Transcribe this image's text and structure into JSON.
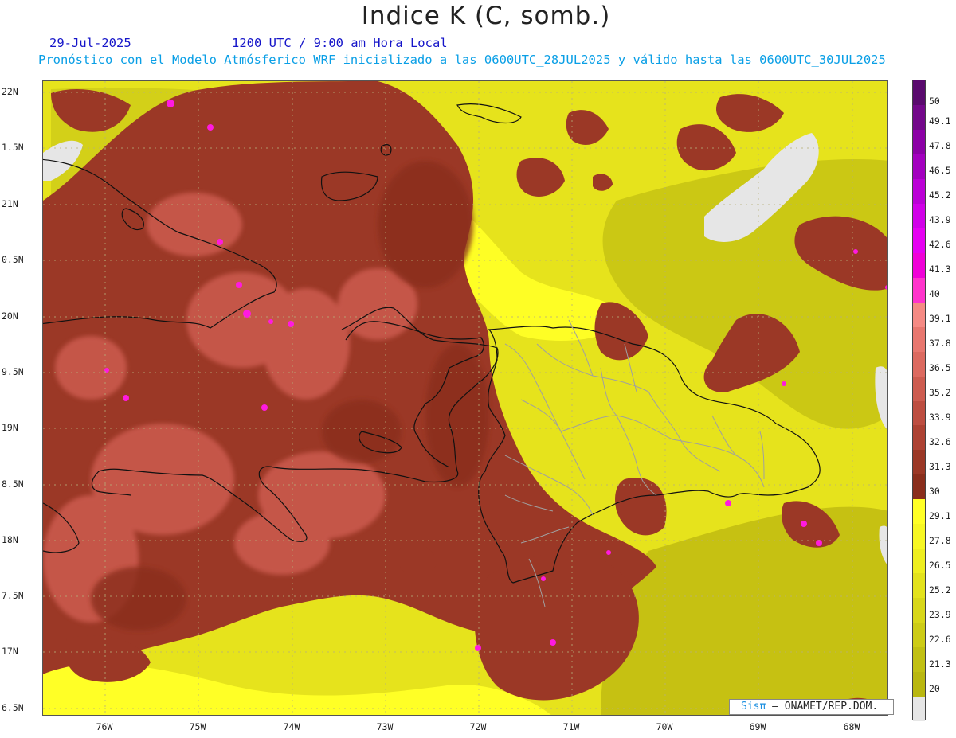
{
  "title": "Indice K (C, somb.)",
  "date": "29-Jul-2025",
  "valid_time": "1200 UTC / 9:00 am Hora Local",
  "forecast_info": "Pronóstico con el Modelo Atmósferico WRF inicializado a las 0600UTC_28JUL2025 y válido hasta las  0600UTC_30JUL2025",
  "lat_labels": [
    "22N",
    "1.5N",
    "21N",
    "0.5N",
    "20N",
    "9.5N",
    "19N",
    "8.5N",
    "18N",
    "7.5N",
    "17N",
    "6.5N"
  ],
  "lon_labels": [
    "76W",
    "75W",
    "74W",
    "73W",
    "72W",
    "71W",
    "70W",
    "69W",
    "68W"
  ],
  "colorbar": {
    "labels": [
      "50",
      "49.1",
      "47.8",
      "46.5",
      "45.2",
      "43.9",
      "42.6",
      "41.3",
      "40",
      "39.1",
      "37.8",
      "36.5",
      "35.2",
      "33.9",
      "32.6",
      "31.3",
      "30",
      "29.1",
      "27.8",
      "26.5",
      "25.2",
      "23.9",
      "22.6",
      "21.3",
      "20"
    ],
    "colors": [
      "#5a0a6e",
      "#73088a",
      "#8c00a6",
      "#a300bf",
      "#bb00d6",
      "#d100e8",
      "#e600f2",
      "#f000d8",
      "#ff33cc",
      "#f58a84",
      "#e8776f",
      "#dc6a60",
      "#cd5c50",
      "#bd4e41",
      "#ad4233",
      "#9b3826",
      "#8a2e1c",
      "#ffff26",
      "#f7f723",
      "#eeee1f",
      "#e3e21c",
      "#d8d719",
      "#cdcc16",
      "#c1c013",
      "#b9b710",
      "#e6e6e6"
    ]
  },
  "credit": {
    "sis": "Sisπ",
    "rest": "– ONAMET/REP.DOM."
  }
}
